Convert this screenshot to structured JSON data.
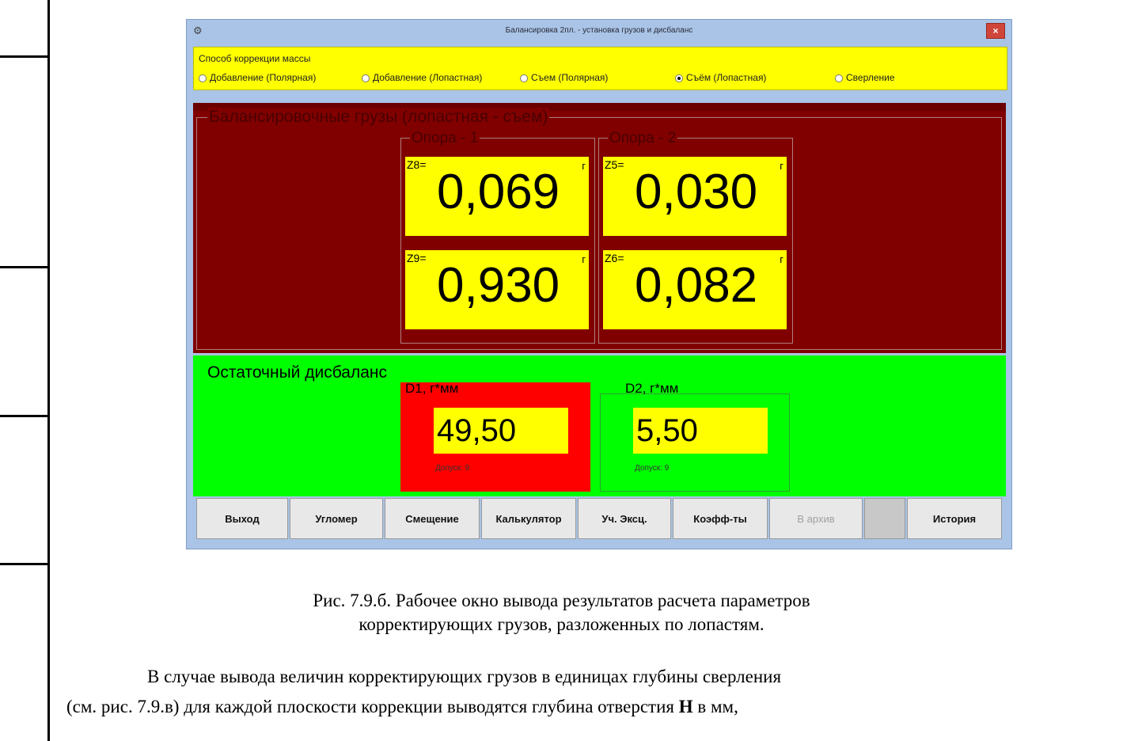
{
  "window": {
    "title": "Балансировка 2пл. - установка грузов и дисбаланс",
    "close_label": "×",
    "app_icon": "settings-icon"
  },
  "correction": {
    "label": "Способ коррекции массы",
    "options": [
      {
        "label": "Добавление (Полярная)",
        "selected": false
      },
      {
        "label": "Добавление (Лопастная)",
        "selected": false
      },
      {
        "label": "Съем (Полярная)",
        "selected": false
      },
      {
        "label": "Съём (Лопастная)",
        "selected": true
      },
      {
        "label": "Сверление",
        "selected": false
      }
    ]
  },
  "weights": {
    "title": "Балансировочные грузы (лопастная - съем)",
    "support1": {
      "title": "Опора - 1",
      "cells": [
        {
          "label": "Z8=",
          "value": "0,069",
          "unit": "г"
        },
        {
          "label": "Z9=",
          "value": "0,930",
          "unit": "г"
        }
      ]
    },
    "support2": {
      "title": "Опора - 2",
      "cells": [
        {
          "label": "Z5=",
          "value": "0,030",
          "unit": "г"
        },
        {
          "label": "Z6=",
          "value": "0,082",
          "unit": "г"
        }
      ]
    }
  },
  "residual": {
    "title": "Остаточный дисбаланс",
    "d1": {
      "title": "D1, г*мм",
      "value": "49,50",
      "tolerance": "Допуск:  9"
    },
    "d2": {
      "title": "D2, г*мм",
      "value": "5,50",
      "tolerance": "Допуск:  9"
    }
  },
  "buttons": [
    "Выход",
    "Угломер",
    "Смещение",
    "Калькулятор",
    "Уч. Эксц.",
    "Коэфф-ты",
    "В архив",
    "",
    "История"
  ],
  "colors": {
    "yellow": "#ffff00",
    "dark_red": "#800000",
    "green": "#00ff00",
    "alert_red": "#ff0000"
  },
  "caption": {
    "line1": "Рис. 7.9.б. Рабочее окно вывода результатов расчета параметров",
    "line2": "корректирующих грузов, разложенных по лопастям."
  },
  "paragraph": {
    "line1": "В случае вывода величин корректирующих грузов в единицах глубины сверления",
    "line2_a": "(см. рис. 7.9.в)  для каждой плоскости коррекции выводятся глубина отверстия ",
    "line2_bold": "H",
    "line2_b": " в мм,"
  }
}
